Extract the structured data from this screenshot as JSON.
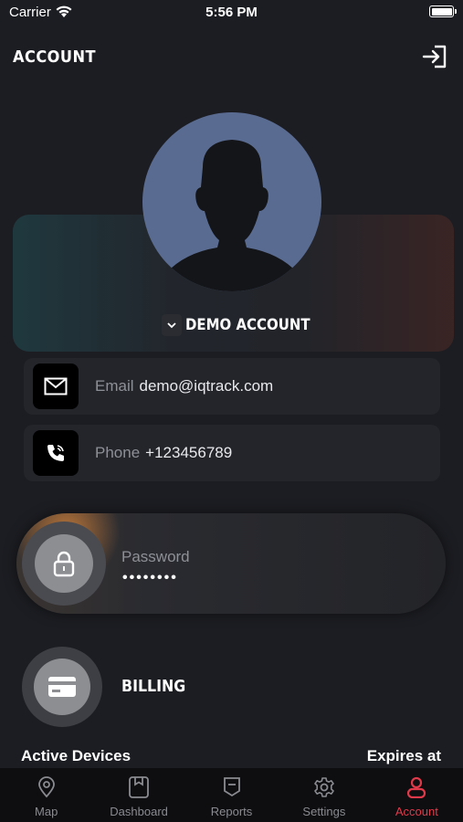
{
  "status_bar": {
    "carrier": "Carrier",
    "time": "5:56 PM"
  },
  "header": {
    "title": "ACCOUNT"
  },
  "profile": {
    "account_name": "DEMO ACCOUNT"
  },
  "contact": {
    "email_label": "Email",
    "email_value": "demo@iqtrack.com",
    "phone_label": "Phone",
    "phone_value": "+123456789"
  },
  "password": {
    "label": "Password",
    "value": "••••••••"
  },
  "billing": {
    "label": "BILLING"
  },
  "devices": {
    "left_heading": "Active Devices",
    "right_heading": "Expires at"
  },
  "tabs": [
    {
      "label": "Map",
      "icon": "map-pin-icon"
    },
    {
      "label": "Dashboard",
      "icon": "dashboard-icon"
    },
    {
      "label": "Reports",
      "icon": "reports-icon"
    },
    {
      "label": "Settings",
      "icon": "gear-icon"
    },
    {
      "label": "Account",
      "icon": "user-icon",
      "active": true
    }
  ],
  "colors": {
    "accent": "#e03a4a",
    "background": "#1c1d22",
    "avatar": "#5a6b91"
  }
}
